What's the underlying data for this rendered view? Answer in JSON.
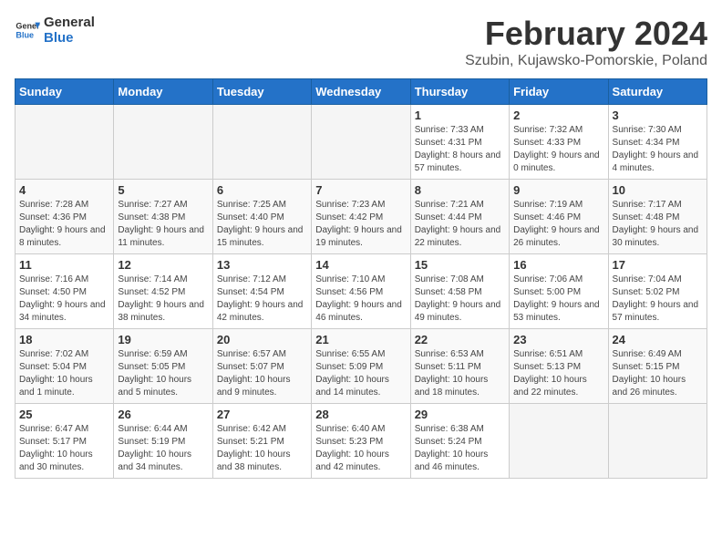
{
  "header": {
    "logo_line1": "General",
    "logo_line2": "Blue",
    "main_title": "February 2024",
    "subtitle": "Szubin, Kujawsko-Pomorskie, Poland"
  },
  "weekdays": [
    "Sunday",
    "Monday",
    "Tuesday",
    "Wednesday",
    "Thursday",
    "Friday",
    "Saturday"
  ],
  "weeks": [
    [
      {
        "day": "",
        "sunrise": "",
        "sunset": "",
        "daylight": "",
        "empty": true
      },
      {
        "day": "",
        "sunrise": "",
        "sunset": "",
        "daylight": "",
        "empty": true
      },
      {
        "day": "",
        "sunrise": "",
        "sunset": "",
        "daylight": "",
        "empty": true
      },
      {
        "day": "",
        "sunrise": "",
        "sunset": "",
        "daylight": "",
        "empty": true
      },
      {
        "day": "1",
        "sunrise": "Sunrise: 7:33 AM",
        "sunset": "Sunset: 4:31 PM",
        "daylight": "Daylight: 8 hours and 57 minutes.",
        "empty": false
      },
      {
        "day": "2",
        "sunrise": "Sunrise: 7:32 AM",
        "sunset": "Sunset: 4:33 PM",
        "daylight": "Daylight: 9 hours and 0 minutes.",
        "empty": false
      },
      {
        "day": "3",
        "sunrise": "Sunrise: 7:30 AM",
        "sunset": "Sunset: 4:34 PM",
        "daylight": "Daylight: 9 hours and 4 minutes.",
        "empty": false
      }
    ],
    [
      {
        "day": "4",
        "sunrise": "Sunrise: 7:28 AM",
        "sunset": "Sunset: 4:36 PM",
        "daylight": "Daylight: 9 hours and 8 minutes.",
        "empty": false
      },
      {
        "day": "5",
        "sunrise": "Sunrise: 7:27 AM",
        "sunset": "Sunset: 4:38 PM",
        "daylight": "Daylight: 9 hours and 11 minutes.",
        "empty": false
      },
      {
        "day": "6",
        "sunrise": "Sunrise: 7:25 AM",
        "sunset": "Sunset: 4:40 PM",
        "daylight": "Daylight: 9 hours and 15 minutes.",
        "empty": false
      },
      {
        "day": "7",
        "sunrise": "Sunrise: 7:23 AM",
        "sunset": "Sunset: 4:42 PM",
        "daylight": "Daylight: 9 hours and 19 minutes.",
        "empty": false
      },
      {
        "day": "8",
        "sunrise": "Sunrise: 7:21 AM",
        "sunset": "Sunset: 4:44 PM",
        "daylight": "Daylight: 9 hours and 22 minutes.",
        "empty": false
      },
      {
        "day": "9",
        "sunrise": "Sunrise: 7:19 AM",
        "sunset": "Sunset: 4:46 PM",
        "daylight": "Daylight: 9 hours and 26 minutes.",
        "empty": false
      },
      {
        "day": "10",
        "sunrise": "Sunrise: 7:17 AM",
        "sunset": "Sunset: 4:48 PM",
        "daylight": "Daylight: 9 hours and 30 minutes.",
        "empty": false
      }
    ],
    [
      {
        "day": "11",
        "sunrise": "Sunrise: 7:16 AM",
        "sunset": "Sunset: 4:50 PM",
        "daylight": "Daylight: 9 hours and 34 minutes.",
        "empty": false
      },
      {
        "day": "12",
        "sunrise": "Sunrise: 7:14 AM",
        "sunset": "Sunset: 4:52 PM",
        "daylight": "Daylight: 9 hours and 38 minutes.",
        "empty": false
      },
      {
        "day": "13",
        "sunrise": "Sunrise: 7:12 AM",
        "sunset": "Sunset: 4:54 PM",
        "daylight": "Daylight: 9 hours and 42 minutes.",
        "empty": false
      },
      {
        "day": "14",
        "sunrise": "Sunrise: 7:10 AM",
        "sunset": "Sunset: 4:56 PM",
        "daylight": "Daylight: 9 hours and 46 minutes.",
        "empty": false
      },
      {
        "day": "15",
        "sunrise": "Sunrise: 7:08 AM",
        "sunset": "Sunset: 4:58 PM",
        "daylight": "Daylight: 9 hours and 49 minutes.",
        "empty": false
      },
      {
        "day": "16",
        "sunrise": "Sunrise: 7:06 AM",
        "sunset": "Sunset: 5:00 PM",
        "daylight": "Daylight: 9 hours and 53 minutes.",
        "empty": false
      },
      {
        "day": "17",
        "sunrise": "Sunrise: 7:04 AM",
        "sunset": "Sunset: 5:02 PM",
        "daylight": "Daylight: 9 hours and 57 minutes.",
        "empty": false
      }
    ],
    [
      {
        "day": "18",
        "sunrise": "Sunrise: 7:02 AM",
        "sunset": "Sunset: 5:04 PM",
        "daylight": "Daylight: 10 hours and 1 minute.",
        "empty": false
      },
      {
        "day": "19",
        "sunrise": "Sunrise: 6:59 AM",
        "sunset": "Sunset: 5:05 PM",
        "daylight": "Daylight: 10 hours and 5 minutes.",
        "empty": false
      },
      {
        "day": "20",
        "sunrise": "Sunrise: 6:57 AM",
        "sunset": "Sunset: 5:07 PM",
        "daylight": "Daylight: 10 hours and 9 minutes.",
        "empty": false
      },
      {
        "day": "21",
        "sunrise": "Sunrise: 6:55 AM",
        "sunset": "Sunset: 5:09 PM",
        "daylight": "Daylight: 10 hours and 14 minutes.",
        "empty": false
      },
      {
        "day": "22",
        "sunrise": "Sunrise: 6:53 AM",
        "sunset": "Sunset: 5:11 PM",
        "daylight": "Daylight: 10 hours and 18 minutes.",
        "empty": false
      },
      {
        "day": "23",
        "sunrise": "Sunrise: 6:51 AM",
        "sunset": "Sunset: 5:13 PM",
        "daylight": "Daylight: 10 hours and 22 minutes.",
        "empty": false
      },
      {
        "day": "24",
        "sunrise": "Sunrise: 6:49 AM",
        "sunset": "Sunset: 5:15 PM",
        "daylight": "Daylight: 10 hours and 26 minutes.",
        "empty": false
      }
    ],
    [
      {
        "day": "25",
        "sunrise": "Sunrise: 6:47 AM",
        "sunset": "Sunset: 5:17 PM",
        "daylight": "Daylight: 10 hours and 30 minutes.",
        "empty": false
      },
      {
        "day": "26",
        "sunrise": "Sunrise: 6:44 AM",
        "sunset": "Sunset: 5:19 PM",
        "daylight": "Daylight: 10 hours and 34 minutes.",
        "empty": false
      },
      {
        "day": "27",
        "sunrise": "Sunrise: 6:42 AM",
        "sunset": "Sunset: 5:21 PM",
        "daylight": "Daylight: 10 hours and 38 minutes.",
        "empty": false
      },
      {
        "day": "28",
        "sunrise": "Sunrise: 6:40 AM",
        "sunset": "Sunset: 5:23 PM",
        "daylight": "Daylight: 10 hours and 42 minutes.",
        "empty": false
      },
      {
        "day": "29",
        "sunrise": "Sunrise: 6:38 AM",
        "sunset": "Sunset: 5:24 PM",
        "daylight": "Daylight: 10 hours and 46 minutes.",
        "empty": false
      },
      {
        "day": "",
        "sunrise": "",
        "sunset": "",
        "daylight": "",
        "empty": true
      },
      {
        "day": "",
        "sunrise": "",
        "sunset": "",
        "daylight": "",
        "empty": true
      }
    ]
  ]
}
